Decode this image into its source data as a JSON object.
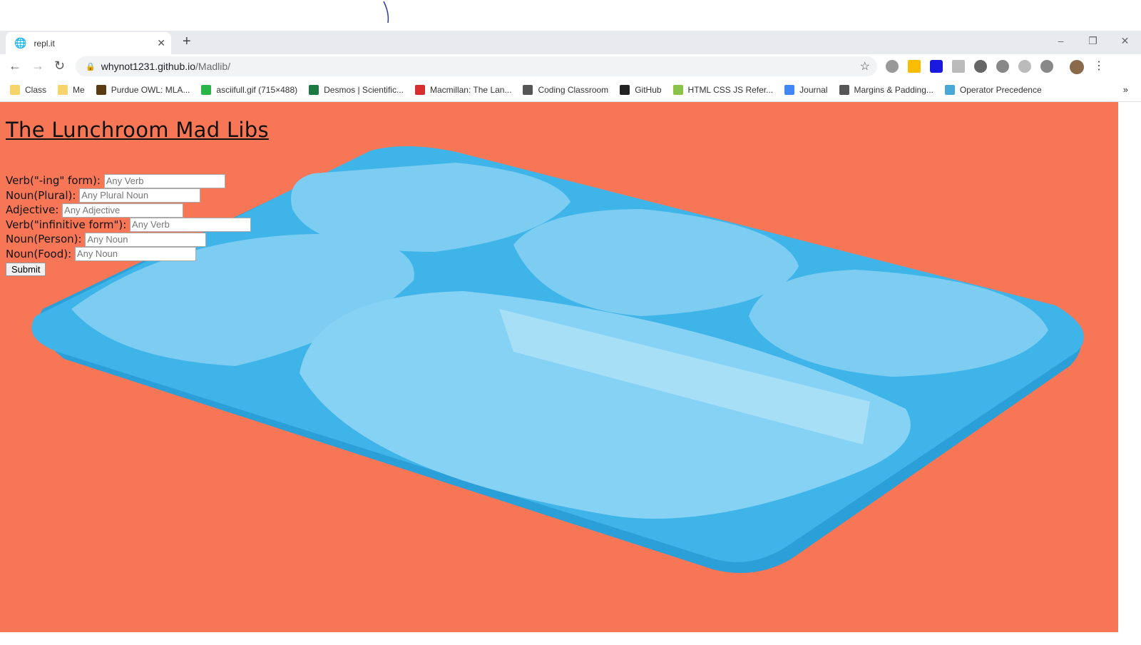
{
  "browser": {
    "tab_title": "repl.it",
    "url_host": "whynot1231.github.io",
    "url_path": "/Madlib/",
    "bookmarks": [
      "Class",
      "Me",
      "Purdue OWL: MLA...",
      "asciifull.gif (715×488)",
      "Desmos | Scientific...",
      "Macmillan: The Lan...",
      "Coding Classroom",
      "GitHub",
      "HTML CSS JS Refer...",
      "Journal",
      "Margins & Padding...",
      "Operator Precedence"
    ],
    "bookmark_colors": [
      "#f7d36b",
      "#f7d36b",
      "#5a3b12",
      "#28b446",
      "#1b7a3f",
      "#d62d2d",
      "#555555",
      "#222222",
      "#8bc34a",
      "#4285f4",
      "#555555",
      "#4aa8d8"
    ]
  },
  "page": {
    "title": "The Lunchroom Mad Libs",
    "background": "#f77656",
    "fields": [
      {
        "label": "Verb(\"-ing\" form):",
        "placeholder": "Any Verb"
      },
      {
        "label": "Noun(Plural):",
        "placeholder": "Any Plural Noun"
      },
      {
        "label": "Adjective:",
        "placeholder": "Any Adjective"
      },
      {
        "label": "Verb(\"infinitive form\"):",
        "placeholder": "Any Verb"
      },
      {
        "label": "Noun(Person):",
        "placeholder": "Any Noun"
      },
      {
        "label": "Noun(Food):",
        "placeholder": "Any Noun"
      }
    ],
    "submit_label": "Submit"
  }
}
